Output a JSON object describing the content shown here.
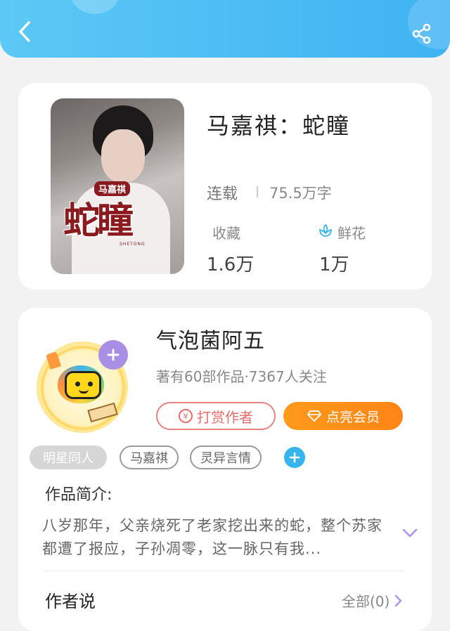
{
  "header": {
    "back_icon": "chevron-left-icon",
    "share_icon": "share-icon"
  },
  "book": {
    "title": "马嘉祺：蛇瞳",
    "status": "连载",
    "word_count": "75.5万字",
    "favorites_label": "收藏",
    "favorites_value": "1.6万",
    "flowers_label": "鲜花",
    "flowers_value": "1万",
    "cover_art": {
      "series": "马嘉祺",
      "title": "蛇瞳",
      "subtitle": "SHETONG"
    }
  },
  "author": {
    "name": "气泡菌阿五",
    "meta": "著有60部作品·7367人关注",
    "tip_label": "打赏作者",
    "tip_icon_text": "¥",
    "vip_label": "点亮会员"
  },
  "tags": [
    "明星同人",
    "马嘉祺",
    "灵异言情"
  ],
  "intro": {
    "label": "作品简介:",
    "text": "八岁那年，父亲烧死了老家挖出来的蛇，整个苏家都遭了报应，子孙凋零，这一脉只有我..."
  },
  "author_says": {
    "label": "作者说",
    "all_label": "全部(0)"
  },
  "colors": {
    "header": "#3fb3f2",
    "accent_orange": "#ff8e1a",
    "tip_red": "#ee6b6b",
    "tag_add_blue": "#35b5ec",
    "avatar_add_purple": "#a98ee6",
    "expand_purple": "#b292e8"
  }
}
